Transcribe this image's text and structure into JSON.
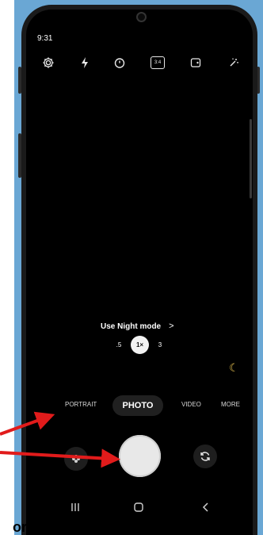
{
  "status": {
    "time": "9:31"
  },
  "topbar": {
    "icons": [
      "settings-icon",
      "flash-icon",
      "timer-icon",
      "aspect-ratio-icon",
      "motion-photo-icon",
      "filters-icon"
    ],
    "aspect_label": "3:4"
  },
  "suggestion": {
    "label": "Use Night mode",
    "chevron": ">"
  },
  "zoom": {
    "half": ".5",
    "one": "1×",
    "three": "3"
  },
  "modes": {
    "portrait": "PORTRAIT",
    "photo": "PHOTO",
    "video": "VIDEO",
    "more": "MORE"
  },
  "bottom_label": "or",
  "colors": {
    "backdrop": "#6aa7d4",
    "arrow": "#e11b1b",
    "moon": "#e5c04f",
    "shutter": "#e8e8e8"
  }
}
